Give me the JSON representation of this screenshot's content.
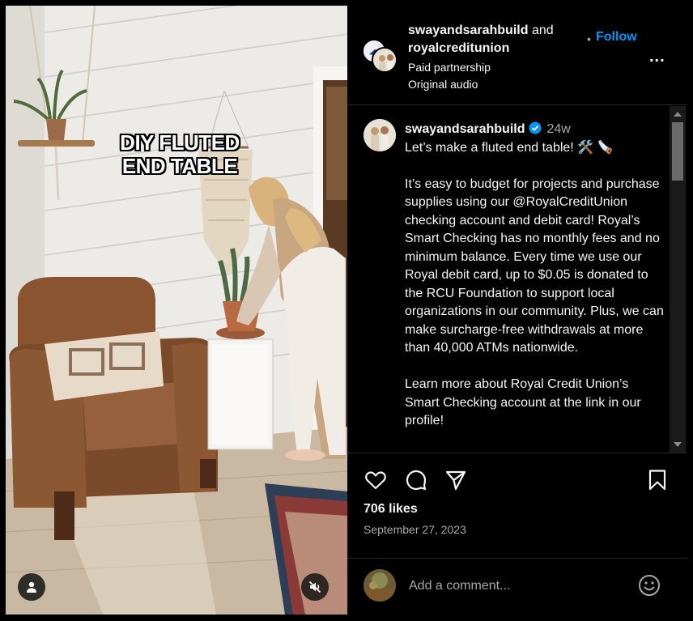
{
  "post": {
    "overlay_title_line1": "DIY FLUTED",
    "overlay_title_line2": "END TABLE"
  },
  "header": {
    "user1": "swayandsarahbuild",
    "and": "and",
    "user2": "royalcreditunion",
    "dot": "•",
    "follow_label": "Follow",
    "subtitle1": "Paid partnership",
    "subtitle2": "Original audio",
    "more": "..."
  },
  "caption": {
    "username": "swayandsarahbuild",
    "time": "24w",
    "text": "Let’s make a fluted end table! 🛠️ 🪚\n\nIt’s easy to budget for projects and purchase supplies using our @RoyalCreditUnion checking account and debit card! Royal’s Smart Checking has no monthly fees and no minimum balance. Every time we use our Royal debit card, up to $0.05 is donated to the RCU Foundation to support local organizations in our community. Plus, we can make surcharge-free withdrawals at more than 40,000 ATMs nationwide.\n\nLearn more about Royal Credit Union’s Smart Checking account at the link in our profile!"
  },
  "actions": {
    "likes": "706 likes",
    "date": "September 27, 2023"
  },
  "comment": {
    "placeholder": "Add a comment..."
  },
  "icons": {
    "like": "heart-icon",
    "comment": "comment-icon",
    "share": "share-icon",
    "save": "bookmark-icon",
    "emoji": "emoji-icon",
    "more": "more-options-icon",
    "verified": "verified-badge-icon",
    "user_tag": "user-tag-icon",
    "mute": "muted-audio-icon"
  },
  "colors": {
    "follow": "#0095f6",
    "verified": "#0095f6",
    "background": "#000000",
    "secondary_text": "#a8a8a8"
  }
}
